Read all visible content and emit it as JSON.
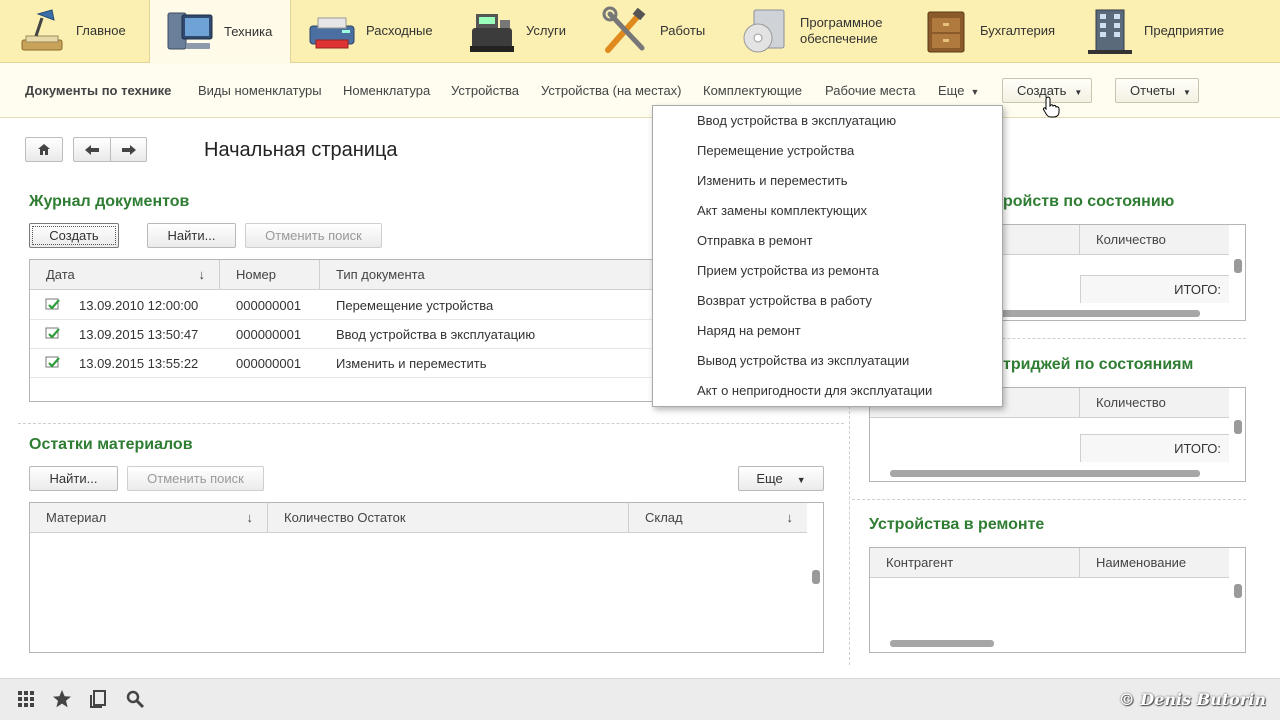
{
  "sections": [
    {
      "label": "Главное",
      "icon": "desk-lamp-icon"
    },
    {
      "label": "Техника",
      "icon": "computer-icon",
      "active": true
    },
    {
      "label": "Расходные",
      "icon": "printer-icon"
    },
    {
      "label": "Услуги",
      "icon": "cash-register-icon"
    },
    {
      "label": "Работы",
      "icon": "tools-icon"
    },
    {
      "label": "Программное обеспечение",
      "icon": "software-disc-icon"
    },
    {
      "label": "Бухгалтерия",
      "icon": "ledger-cabinet-icon"
    },
    {
      "label": "Предприятие",
      "icon": "building-icon"
    }
  ],
  "submenu": {
    "items": [
      "Документы по технике",
      "Виды номенклатуры",
      "Номенклатура",
      "Устройства",
      "Устройства (на местах)",
      "Комплектующие",
      "Рабочие места"
    ],
    "more": "Еще",
    "create": "Создать",
    "reports": "Отчеты"
  },
  "create_menu": [
    "Ввод устройства в эксплуатацию",
    "Перемещение устройства",
    "Изменить и переместить",
    "Акт замены комплектующих",
    "Отправка в ремонт",
    "Прием устройства из ремонта",
    "Возврат устройства в работу",
    "Наряд на ремонт",
    "Вывод устройства из эксплуатации",
    "Акт о непригодности для эксплуатации"
  ],
  "page_title": "Начальная страница",
  "journal": {
    "title": "Журнал документов",
    "btn_create": "Создать",
    "btn_find": "Найти...",
    "btn_cancel": "Отменить поиск",
    "columns": [
      "Дата",
      "Номер",
      "Тип документа"
    ],
    "rows": [
      {
        "date": "13.09.2010 12:00:00",
        "number": "000000001",
        "type": "Перемещение устройства"
      },
      {
        "date": "13.09.2015 13:50:47",
        "number": "000000001",
        "type": "Ввод устройства в эксплуатацию"
      },
      {
        "date": "13.09.2015 13:55:22",
        "number": "000000001",
        "type": "Изменить и переместить"
      }
    ]
  },
  "materials": {
    "title": "Остатки материалов",
    "btn_find": "Найти...",
    "btn_cancel": "Отменить поиск",
    "btn_more": "Еще",
    "columns": [
      "Материал",
      "Количество Остаток",
      "Склад"
    ]
  },
  "devices_state": {
    "title": "ройств по состоянию",
    "col_qty": "Количество",
    "total": "ИТОГО:"
  },
  "cartridges_state": {
    "title": "триджей по состояниям",
    "col_qty": "Количество",
    "total": "ИТОГО:"
  },
  "repair": {
    "title": "Устройства в ремонте",
    "columns": [
      "Контрагент",
      "Наименование"
    ]
  },
  "watermark": "© Denis Butorin"
}
